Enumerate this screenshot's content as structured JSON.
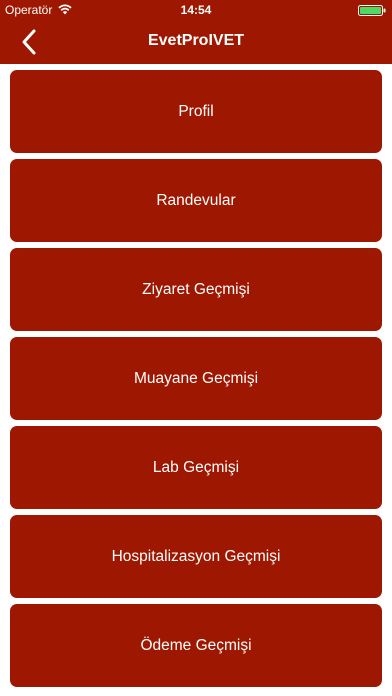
{
  "status_bar": {
    "carrier": "Operatör",
    "time": "14:54",
    "wifi_icon": "wifi-icon",
    "battery_icon": "battery-icon"
  },
  "nav": {
    "title": "EvetProIVET",
    "back_icon": "chevron-left-icon"
  },
  "menu": {
    "items": [
      {
        "label": "Profil"
      },
      {
        "label": "Randevular"
      },
      {
        "label": "Ziyaret Geçmişi"
      },
      {
        "label": "Muayane Geçmişi"
      },
      {
        "label": "Lab Geçmişi"
      },
      {
        "label": "Hospitalizasyon Geçmişi"
      },
      {
        "label": "Ödeme Geçmişi"
      }
    ]
  },
  "colors": {
    "brand": "#9e1700",
    "text": "#ffffff",
    "battery": "#4cd964"
  }
}
